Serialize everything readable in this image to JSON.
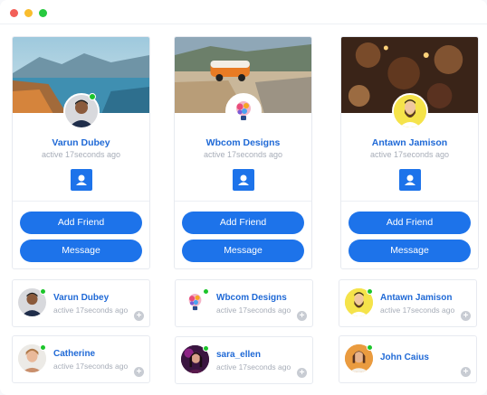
{
  "window": {
    "dots": [
      "#f25f58",
      "#f9bd2e",
      "#27c93f"
    ]
  },
  "cards": [
    {
      "name": "Varun Dubey",
      "active": "active 17seconds ago",
      "add_friend": "Add Friend",
      "message": "Message",
      "online": true
    },
    {
      "name": "Wbcom Designs",
      "active": "active 17seconds ago",
      "add_friend": "Add Friend",
      "message": "Message",
      "online": false
    },
    {
      "name": "Antawn Jamison",
      "active": "active 17seconds ago",
      "add_friend": "Add Friend",
      "message": "Message",
      "online": false
    }
  ],
  "members": [
    {
      "name": "Varun Dubey",
      "active": "active 17seconds ago"
    },
    {
      "name": "Wbcom Designs",
      "active": "active 17seconds ago"
    },
    {
      "name": "Antawn Jamison",
      "active": "active 17seconds ago"
    },
    {
      "name": "Catherine",
      "active": "active 17seconds ago"
    },
    {
      "name": "sara_ellen",
      "active": "active 17seconds ago"
    },
    {
      "name": "John Caius",
      "active": ""
    }
  ],
  "accent": "#1d73ea",
  "plus_glyph": "+",
  "icons": [
    "user-icon",
    "plus-icon"
  ]
}
